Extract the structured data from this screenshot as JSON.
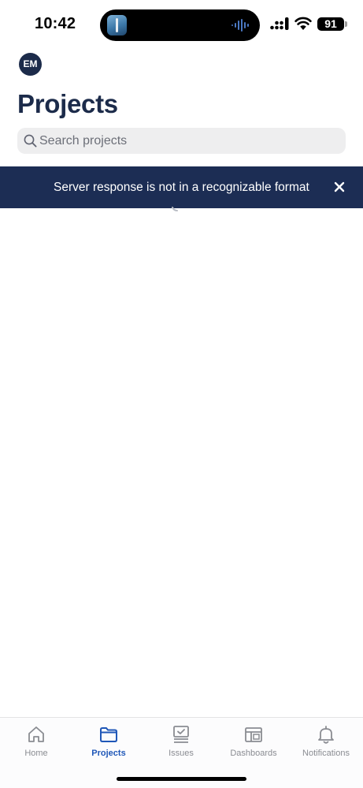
{
  "status_bar": {
    "time": "10:42",
    "battery": "91"
  },
  "header": {
    "avatar_initials": "EM",
    "title": "Projects"
  },
  "search": {
    "placeholder": "Search projects",
    "value": ""
  },
  "banner": {
    "message": "Server response is not in a recognizable format",
    "close_icon": "close-icon"
  },
  "tabs": [
    {
      "label": "Home",
      "icon": "home-icon",
      "active": false
    },
    {
      "label": "Projects",
      "icon": "folder-icon",
      "active": true
    },
    {
      "label": "Issues",
      "icon": "issues-icon",
      "active": false
    },
    {
      "label": "Dashboards",
      "icon": "dashboard-icon",
      "active": false
    },
    {
      "label": "Notifications",
      "icon": "bell-icon",
      "active": false
    }
  ],
  "colors": {
    "primary_navy": "#1c2b4a",
    "banner_bg": "#1c2d54",
    "active_tab": "#1f57b8",
    "inactive_tab": "#8a8c92"
  }
}
